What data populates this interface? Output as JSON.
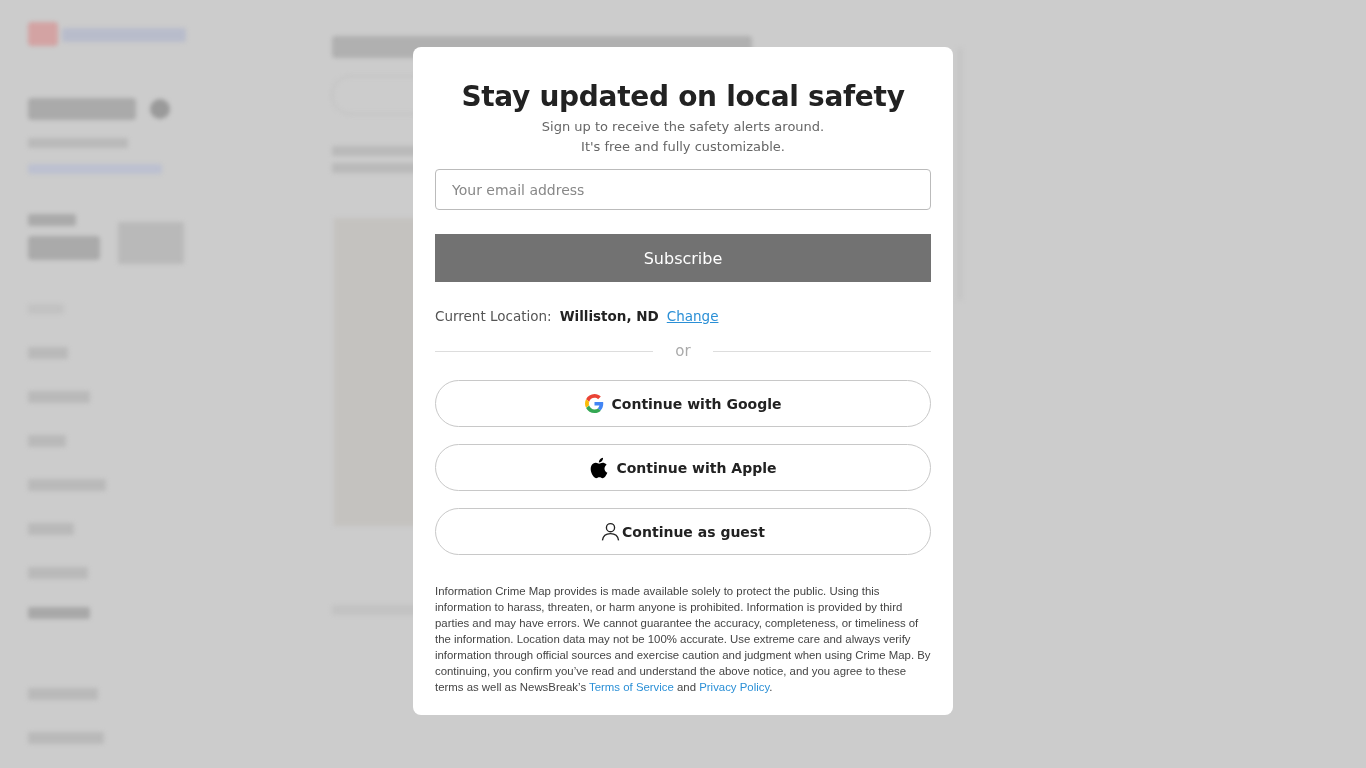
{
  "modal": {
    "title": "Stay updated on local safety",
    "subtitle_lines": [
      "Sign up to receive the safety alerts around.",
      "It's free and fully customizable."
    ],
    "email_field": {
      "placeholder": "Your email address"
    },
    "subscribe_button": "Subscribe",
    "location": {
      "label": "Current Location:",
      "value": "Williston, ND",
      "change_link": "Change"
    },
    "divider": "or",
    "sign_in_buttons": [
      {
        "kind": "google",
        "label": "Continue with Google"
      },
      {
        "kind": "apple",
        "label": "Continue with Apple"
      },
      {
        "kind": "guest",
        "label": "Continue as guest"
      }
    ],
    "disclaimer": [
      {
        "kind": "text",
        "text": "Information Crime Map provides is made available solely to protect the public. Using this information to harass, threaten, or harm anyone is prohibited. Information is provided by third parties and may have errors. We cannot guarantee the accuracy, completeness, or timeliness of the information. Location data may not be 100% accurate. Use extreme care and always verify information through official sources and exercise caution and judgment when using Crime Map. By continuing, you confirm you’ve read and understand the above notice, and you agree to these terms as well as NewsBreak’s "
      },
      {
        "kind": "link",
        "text": "Terms of Service"
      },
      {
        "kind": "text",
        "text": " and "
      },
      {
        "kind": "link",
        "text": "Privacy Policy"
      },
      {
        "kind": "text",
        "text": "."
      }
    ]
  }
}
